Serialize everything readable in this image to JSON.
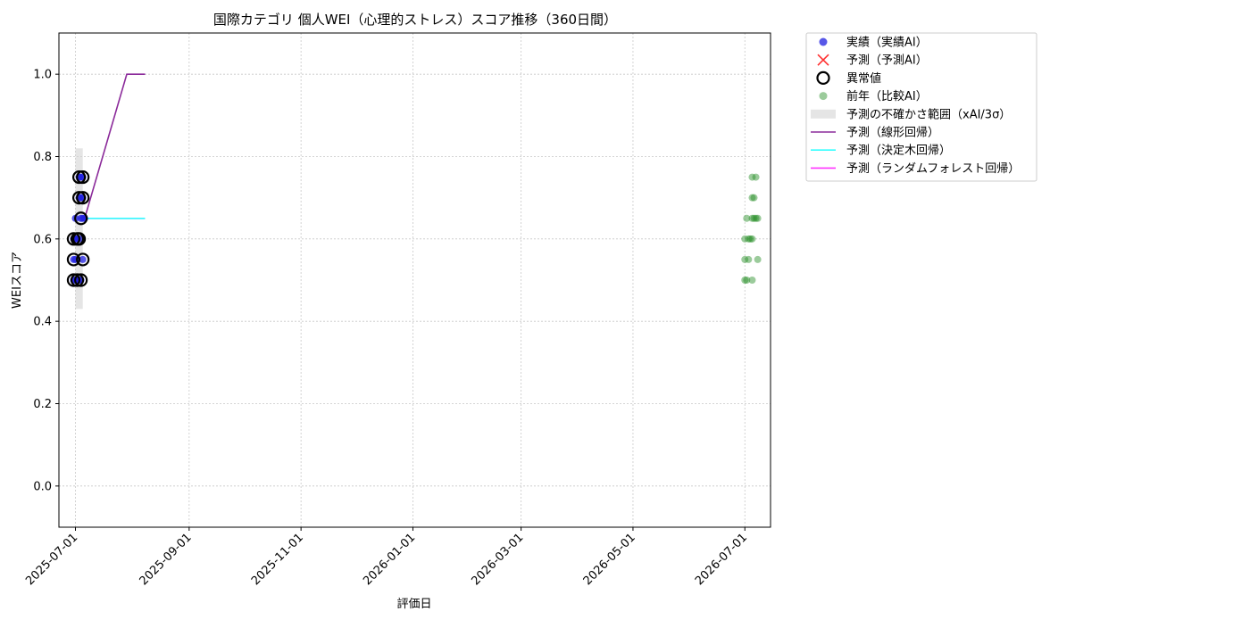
{
  "chart_data": {
    "type": "scatter",
    "title": "国際カテゴリ 個人WEI（心理的ストレス）スコア推移（360日間）",
    "xlabel": "評価日",
    "ylabel": "WEIスコア",
    "xlim": [
      "2025-06-22",
      "2026-07-15"
    ],
    "ylim": [
      -0.1,
      1.1
    ],
    "x_ticks": [
      "2025-07-01",
      "2025-09-01",
      "2025-11-01",
      "2026-01-01",
      "2026-03-01",
      "2026-05-01",
      "2026-07-01"
    ],
    "y_ticks": [
      "0.0",
      "0.2",
      "0.4",
      "0.6",
      "0.8",
      "1.0"
    ],
    "grid": true,
    "legend_position": "outside-right-top",
    "colors": {
      "actual": "#1f1fe0",
      "predicted": "#ff3030",
      "anomaly": "#000000",
      "last_year": "#228b22",
      "band": "#d3d3d3",
      "linear": "#8b2a9a",
      "tree": "#33ffff",
      "forest": "#ff33ff"
    },
    "uncertainty_band": {
      "x": [
        "2025-07-01",
        "2025-07-05"
      ],
      "y": [
        0.43,
        0.82
      ]
    },
    "series": [
      {
        "name": "実績（実績AI）",
        "kind": "actual",
        "points": [
          {
            "x": "2025-06-30",
            "y": 0.5
          },
          {
            "x": "2025-07-01",
            "y": 0.5
          },
          {
            "x": "2025-07-02",
            "y": 0.5
          },
          {
            "x": "2025-07-03",
            "y": 0.5
          },
          {
            "x": "2025-07-04",
            "y": 0.5
          },
          {
            "x": "2025-06-30",
            "y": 0.55
          },
          {
            "x": "2025-07-01",
            "y": 0.55
          },
          {
            "x": "2025-07-05",
            "y": 0.55
          },
          {
            "x": "2025-06-30",
            "y": 0.6
          },
          {
            "x": "2025-07-01",
            "y": 0.6
          },
          {
            "x": "2025-07-02",
            "y": 0.6
          },
          {
            "x": "2025-07-03",
            "y": 0.6
          },
          {
            "x": "2025-07-01",
            "y": 0.65
          },
          {
            "x": "2025-07-04",
            "y": 0.65
          },
          {
            "x": "2025-07-05",
            "y": 0.65
          },
          {
            "x": "2025-07-06",
            "y": 0.65
          },
          {
            "x": "2025-07-03",
            "y": 0.7
          },
          {
            "x": "2025-07-04",
            "y": 0.7
          },
          {
            "x": "2025-07-05",
            "y": 0.7
          },
          {
            "x": "2025-07-03",
            "y": 0.75
          },
          {
            "x": "2025-07-04",
            "y": 0.75
          },
          {
            "x": "2025-07-05",
            "y": 0.75
          }
        ]
      },
      {
        "name": "予測（予測AI）",
        "kind": "predicted",
        "points": []
      },
      {
        "name": "異常値",
        "kind": "anomaly",
        "points": [
          {
            "x": "2025-06-30",
            "y": 0.5
          },
          {
            "x": "2025-07-02",
            "y": 0.5
          },
          {
            "x": "2025-07-04",
            "y": 0.5
          },
          {
            "x": "2025-06-30",
            "y": 0.55
          },
          {
            "x": "2025-07-05",
            "y": 0.55
          },
          {
            "x": "2025-06-30",
            "y": 0.6
          },
          {
            "x": "2025-07-02",
            "y": 0.6
          },
          {
            "x": "2025-07-03",
            "y": 0.6
          },
          {
            "x": "2025-07-04",
            "y": 0.65
          },
          {
            "x": "2025-07-03",
            "y": 0.7
          },
          {
            "x": "2025-07-05",
            "y": 0.7
          },
          {
            "x": "2025-07-03",
            "y": 0.75
          },
          {
            "x": "2025-07-05",
            "y": 0.75
          }
        ]
      },
      {
        "name": "前年（比較AI）",
        "kind": "last_year",
        "points": [
          {
            "x": "2026-07-01",
            "y": 0.5
          },
          {
            "x": "2026-07-02",
            "y": 0.5
          },
          {
            "x": "2026-07-05",
            "y": 0.5
          },
          {
            "x": "2026-07-01",
            "y": 0.55
          },
          {
            "x": "2026-07-03",
            "y": 0.55
          },
          {
            "x": "2026-07-08",
            "y": 0.55
          },
          {
            "x": "2026-07-01",
            "y": 0.6
          },
          {
            "x": "2026-07-03",
            "y": 0.6
          },
          {
            "x": "2026-07-04",
            "y": 0.6
          },
          {
            "x": "2026-07-05",
            "y": 0.6
          },
          {
            "x": "2026-07-02",
            "y": 0.65
          },
          {
            "x": "2026-07-05",
            "y": 0.65
          },
          {
            "x": "2026-07-06",
            "y": 0.65
          },
          {
            "x": "2026-07-07",
            "y": 0.65
          },
          {
            "x": "2026-07-08",
            "y": 0.65
          },
          {
            "x": "2026-07-05",
            "y": 0.7
          },
          {
            "x": "2026-07-06",
            "y": 0.7
          },
          {
            "x": "2026-07-05",
            "y": 0.75
          },
          {
            "x": "2026-07-07",
            "y": 0.75
          }
        ]
      }
    ],
    "lines": [
      {
        "name": "予測（線形回帰）",
        "kind": "linear",
        "points": [
          {
            "x": "2025-07-06",
            "y": 0.65
          },
          {
            "x": "2025-07-29",
            "y": 1.0
          },
          {
            "x": "2025-08-08",
            "y": 1.0
          }
        ]
      },
      {
        "name": "予測（決定木回帰）",
        "kind": "tree",
        "points": [
          {
            "x": "2025-07-06",
            "y": 0.65
          },
          {
            "x": "2025-08-08",
            "y": 0.65
          }
        ]
      },
      {
        "name": "予測（ランダムフォレスト回帰）",
        "kind": "forest",
        "points": [
          {
            "x": "2025-07-06",
            "y": 0.65
          },
          {
            "x": "2025-08-08",
            "y": 0.65
          }
        ]
      }
    ],
    "legend": [
      {
        "label": "実績（実績AI）",
        "kind": "actual"
      },
      {
        "label": "予測（予測AI）",
        "kind": "predicted"
      },
      {
        "label": "異常値",
        "kind": "anomaly"
      },
      {
        "label": "前年（比較AI）",
        "kind": "last_year"
      },
      {
        "label": "予測の不確かさ範囲（xAI/3σ）",
        "kind": "band"
      },
      {
        "label": "予測（線形回帰）",
        "kind": "linear"
      },
      {
        "label": "予測（決定木回帰）",
        "kind": "tree"
      },
      {
        "label": "予測（ランダムフォレスト回帰）",
        "kind": "forest"
      }
    ]
  }
}
